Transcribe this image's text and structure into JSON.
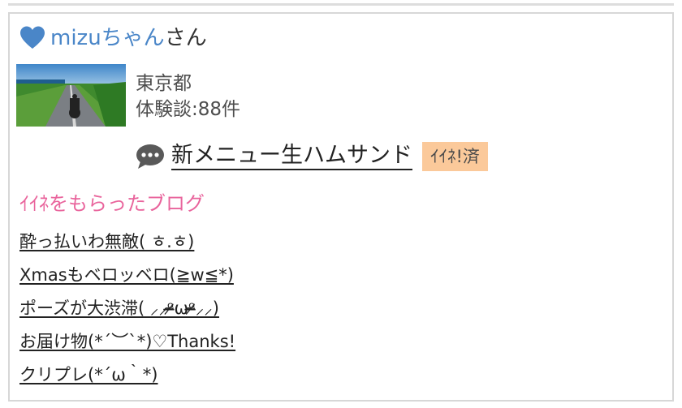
{
  "user": {
    "name": "mizuちゃん",
    "suffix": "さん",
    "location": "東京都",
    "experiences": "体験談:88件"
  },
  "post": {
    "title": "新メニュー生ハムサンド",
    "badge": "ｲｲﾈ!済"
  },
  "liked_blogs": {
    "title": "ｲｲﾈをもらったブログ",
    "items": [
      "酔っ払いわ無敵( ㅎ.ㅎ)",
      "Xmasもベロッベロ(≧w≦*)",
      "ポーズが大渋滞( ⸝⸝ᵒ̴̶̷ωᵒ̴̶̷⸝⸝)",
      "お届け物(*´︶`*)♡Thanks!",
      "クリプレ(*´ω｀*)"
    ]
  },
  "colors": {
    "heart": "#4a86c8",
    "username": "#4a86c8",
    "section_title": "#e9649c",
    "badge_bg": "#fbc99a"
  },
  "icons": [
    "heart-icon",
    "comment-icon"
  ]
}
